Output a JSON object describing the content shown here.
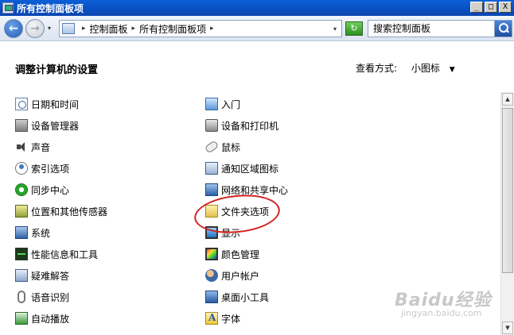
{
  "window": {
    "title": "所有控制面板项",
    "buttons": {
      "minimize": "_",
      "maximize": "□",
      "close": "X"
    }
  },
  "nav": {
    "back_icon": "back-arrow-icon",
    "forward_icon": "forward-arrow-icon",
    "back_glyph": "←",
    "forward_glyph": "→",
    "dropdown_glyph": "▾",
    "breadcrumbs": [
      "控制面板",
      "所有控制面板项"
    ],
    "separator": "▸",
    "search_placeholder": "搜索控制面板"
  },
  "content": {
    "heading": "调整计算机的设置",
    "view_by_label": "查看方式:",
    "view_by_value": "小图标",
    "caret": "▼"
  },
  "items": {
    "left": [
      {
        "label": "日期和时间",
        "icon": "datetime"
      },
      {
        "label": "设备管理器",
        "icon": "devmgr"
      },
      {
        "label": "声音",
        "icon": "sound"
      },
      {
        "label": "索引选项",
        "icon": "indexing"
      },
      {
        "label": "同步中心",
        "icon": "sync"
      },
      {
        "label": "位置和其他传感器",
        "icon": "location"
      },
      {
        "label": "系统",
        "icon": "system"
      },
      {
        "label": "性能信息和工具",
        "icon": "perf"
      },
      {
        "label": "疑难解答",
        "icon": "troubleshoot"
      },
      {
        "label": "语音识别",
        "icon": "speech"
      },
      {
        "label": "自动播放",
        "icon": "autoplay"
      }
    ],
    "right": [
      {
        "label": "入门",
        "icon": "getstarted"
      },
      {
        "label": "设备和打印机",
        "icon": "printers"
      },
      {
        "label": "鼠标",
        "icon": "mouse"
      },
      {
        "label": "通知区域图标",
        "icon": "notify"
      },
      {
        "label": "网络和共享中心",
        "icon": "network"
      },
      {
        "label": "文件夹选项",
        "icon": "folder"
      },
      {
        "label": "显示",
        "icon": "display"
      },
      {
        "label": "颜色管理",
        "icon": "color"
      },
      {
        "label": "用户帐户",
        "icon": "users"
      },
      {
        "label": "桌面小工具",
        "icon": "gadgets"
      },
      {
        "label": "字体",
        "icon": "fonts"
      }
    ]
  },
  "scrollbar": {
    "up": "▲",
    "down": "▼"
  },
  "watermark": {
    "main": "Baidu经验",
    "sub": "jingyan.baidu.com"
  },
  "colors": {
    "title_bar": "#0a4fc1",
    "annotation": "#d42020"
  }
}
